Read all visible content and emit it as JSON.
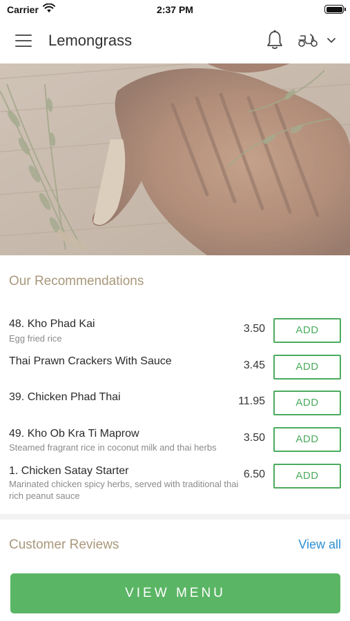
{
  "status_bar": {
    "carrier": "Carrier",
    "time": "2:37 PM"
  },
  "header": {
    "title": "Lemongrass"
  },
  "recommendations": {
    "title": "Our Recommendations",
    "items": [
      {
        "name": "48. Kho Phad Kai",
        "description": "Egg fried rice",
        "price": "3.50",
        "button": "ADD"
      },
      {
        "name": "Thai Prawn Crackers With Sauce",
        "description": "",
        "price": "3.45",
        "button": "ADD"
      },
      {
        "name": "39. Chicken Phad Thai",
        "description": "",
        "price": "11.95",
        "button": "ADD"
      },
      {
        "name": "49. Kho Ob Kra Ti Maprow",
        "description": "Steamed fragrant rice in coconut milk and thai herbs",
        "price": "3.50",
        "button": "ADD"
      },
      {
        "name": "1. Chicken Satay Starter",
        "description": "Marinated chicken spicy herbs, served with traditional thai rich peanut sauce",
        "price": "6.50",
        "button": "ADD"
      }
    ]
  },
  "reviews": {
    "title": "Customer Reviews",
    "view_all": "View all"
  },
  "footer": {
    "view_menu": "VIEW MENU"
  },
  "colors": {
    "accent_green": "#5ab565",
    "heading_tan": "#a8987a",
    "link_blue": "#2e8fd1"
  },
  "icons": [
    "wifi-icon",
    "battery-icon",
    "menu-icon",
    "bell-icon",
    "scooter-icon",
    "chevron-down-icon"
  ]
}
